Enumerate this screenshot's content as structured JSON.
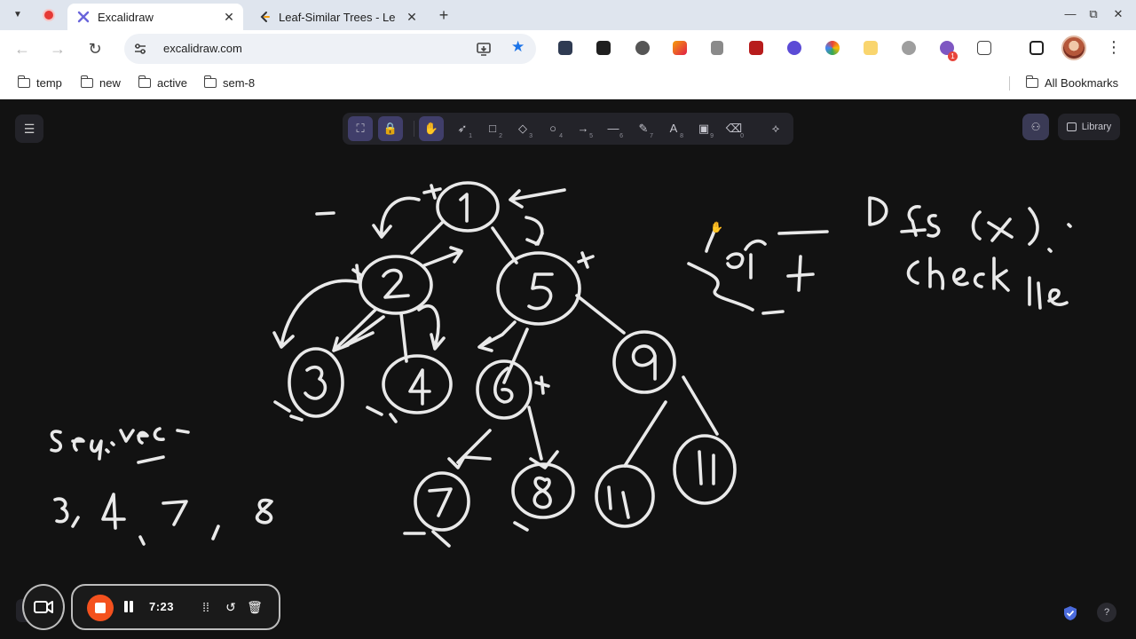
{
  "browser": {
    "tabs": [
      {
        "title": "Excalidraw",
        "active": true
      },
      {
        "title": "Leaf-Similar Trees - Le",
        "active": false
      }
    ],
    "url": "excalidraw.com",
    "bookmarks": [
      "temp",
      "new",
      "active",
      "sem-8"
    ],
    "all_bookmarks": "All Bookmarks"
  },
  "excalidraw": {
    "toolbar": [
      {
        "name": "keep-tool-active",
        "icon": "pin-icon",
        "glyph": "⛶",
        "num": ""
      },
      {
        "name": "lock",
        "icon": "lock-icon",
        "glyph": "🔒",
        "num": ""
      },
      {
        "name": "hand",
        "icon": "hand-icon",
        "glyph": "✋",
        "num": ""
      },
      {
        "name": "selection",
        "icon": "cursor-icon",
        "glyph": "➶",
        "num": "1"
      },
      {
        "name": "rectangle",
        "icon": "square-icon",
        "glyph": "□",
        "num": "2"
      },
      {
        "name": "diamond",
        "icon": "diamond-icon",
        "glyph": "◇",
        "num": "3"
      },
      {
        "name": "ellipse",
        "icon": "circle-icon",
        "glyph": "○",
        "num": "4"
      },
      {
        "name": "arrow",
        "icon": "arrow-icon",
        "glyph": "→",
        "num": "5"
      },
      {
        "name": "line",
        "icon": "line-icon",
        "glyph": "—",
        "num": "6"
      },
      {
        "name": "draw",
        "icon": "pencil-icon",
        "glyph": "✎",
        "num": "7"
      },
      {
        "name": "text",
        "icon": "text-icon",
        "glyph": "A",
        "num": "8"
      },
      {
        "name": "image",
        "icon": "image-icon",
        "glyph": "▣",
        "num": "9"
      },
      {
        "name": "eraser",
        "icon": "eraser-icon",
        "glyph": "⌫",
        "num": "0"
      },
      {
        "name": "more-tools",
        "icon": "shapes-icon",
        "glyph": "⟡",
        "num": ""
      }
    ],
    "library_label": "Library"
  },
  "recorder": {
    "time": "7:23"
  },
  "colors": {
    "canvas": "#121212",
    "accent": "#403e6a",
    "stroke": "#e9e9e9",
    "record": "#f4511e"
  }
}
